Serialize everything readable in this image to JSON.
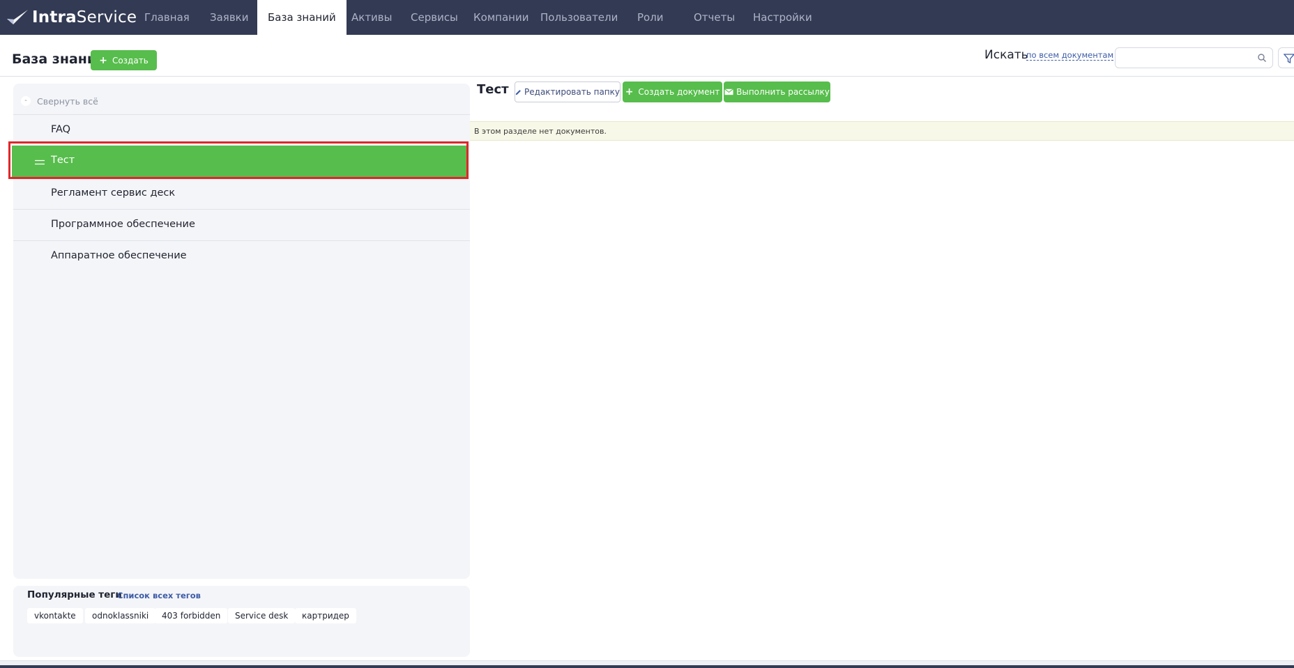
{
  "app": {
    "logo_bold": "Intra",
    "logo_light": "Service"
  },
  "nav": {
    "items": [
      {
        "label": "Главная"
      },
      {
        "label": "Заявки"
      },
      {
        "label": "База знаний",
        "active": true
      },
      {
        "label": "Активы"
      },
      {
        "label": "Сервисы"
      },
      {
        "label": "Компании"
      },
      {
        "label": "Пользователи"
      },
      {
        "label": "Роли"
      },
      {
        "label": "Отчеты"
      },
      {
        "label": "Настройки"
      }
    ]
  },
  "header": {
    "title": "База знаний",
    "create_label": "Создать",
    "search_label": "Искать",
    "search_scope": "по всем документам",
    "search_value": ""
  },
  "tree": {
    "collapse_symbol": "-",
    "collapse_label": "Свернуть всё",
    "items": [
      {
        "label": "FAQ"
      },
      {
        "label": "Тест",
        "selected": true
      },
      {
        "label": "Регламент сервис деск"
      },
      {
        "label": "Программное обеспечение"
      },
      {
        "label": "Аппаратное обеспечение"
      }
    ]
  },
  "tags": {
    "title": "Популярные теги",
    "all_link": "Список всех тегов",
    "items": [
      "vkontakte",
      "odnoklassniki",
      "403 forbidden",
      "Service desk",
      "картридер"
    ]
  },
  "content": {
    "folder_title": "Тест",
    "edit_folder_label": "Редактировать папку",
    "create_doc_label": "Создать документ",
    "mailing_label": "Выполнить рассылку",
    "empty_message": "В этом разделе нет документов."
  },
  "colors": {
    "nav_bg": "#333a54",
    "accent_green": "#57bd4c",
    "highlight_red": "#e0262a",
    "link_blue": "#3d5ca8"
  }
}
